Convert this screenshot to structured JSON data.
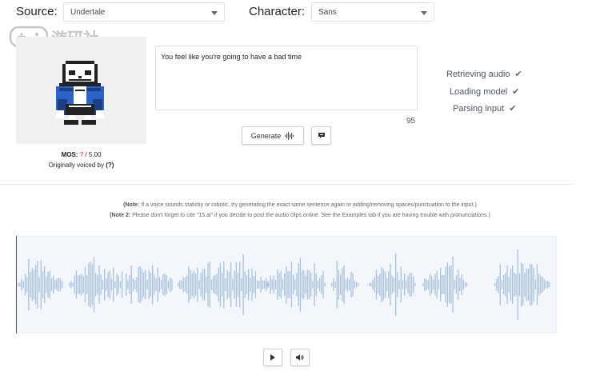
{
  "header": {
    "source_label": "Source:",
    "source_value": "Undertale",
    "character_label": "Character:",
    "character_value": "Sans"
  },
  "watermark": {
    "text": "游研社"
  },
  "portrait": {
    "mos_label": "MOS:",
    "mos_value": "?",
    "mos_max": "/ 5.00",
    "voiced_by": "Originally voiced by",
    "voiced_value": "(?)"
  },
  "input": {
    "text": "You feel like you're going to have a bad time",
    "char_count": "95"
  },
  "actions": {
    "generate_label": "Generate",
    "generate_icon": "waveform-icon",
    "feedback_icon": "speech-bubble-icon"
  },
  "status": [
    {
      "label": "Retrieving audio",
      "icon": "check-icon"
    },
    {
      "label": "Loading model",
      "icon": "check-icon"
    },
    {
      "label": "Parsing input",
      "icon": "check-icon"
    }
  ],
  "notes": {
    "note1_prefix": "(Note:",
    "note1_text": " If a voice sounds staticky or robotic, try generating the exact same sentence again or adding/removing spaces/punctuation to the input.)",
    "note2_prefix": "(Note 2:",
    "note2_text": " Please don't forget to cite \"15.ai\" if you decide to post the audio clips online. See the Examples tab if you are having trouble with pronunciations.)"
  },
  "player": {
    "play_icon": "play-icon",
    "volume_icon": "volume-icon",
    "wave_color": "#a8c0dc"
  },
  "colors": {
    "background": "#ffffff",
    "wave_bg": "#f3f7fb",
    "sans_blue": "#2c63c8"
  }
}
